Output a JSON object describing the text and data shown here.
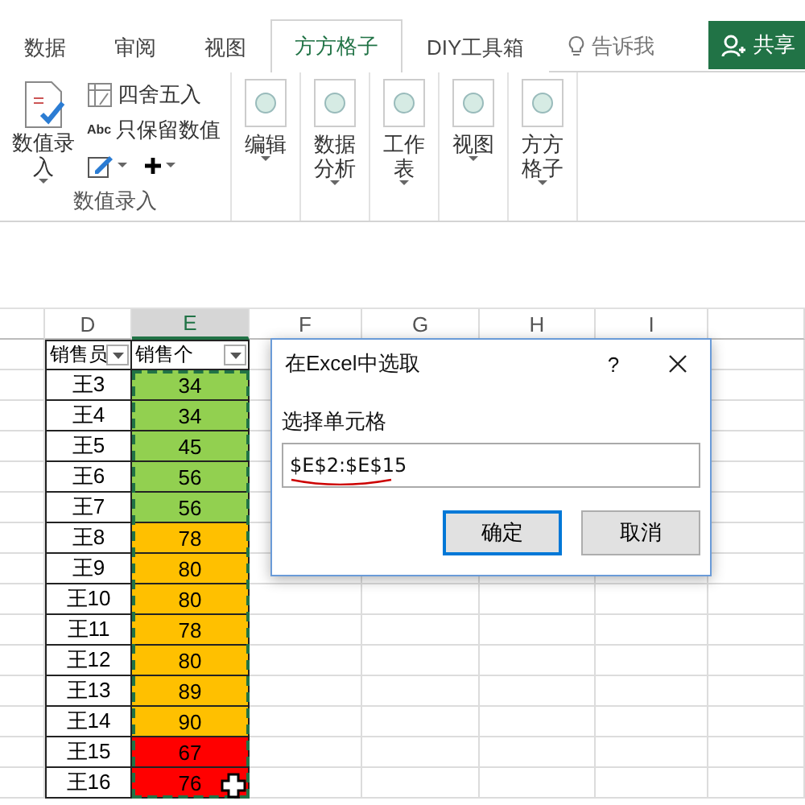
{
  "tabs": [
    {
      "label": "数据",
      "selected": false
    },
    {
      "label": "审阅",
      "selected": false
    },
    {
      "label": "视图",
      "selected": false
    },
    {
      "label": "方方格子",
      "selected": true
    },
    {
      "label": "DIY工具箱",
      "selected": false
    }
  ],
  "tell_me": {
    "label": "告诉我"
  },
  "share_button": {
    "label": "共享"
  },
  "ribbon": {
    "group": {
      "label": "数值录入",
      "big_button": {
        "label": "数值录入"
      },
      "small_buttons": [
        {
          "kind": "table",
          "label": "四舍五入"
        },
        {
          "kind": "abc",
          "icon_text": "Abc",
          "label": "只保留数值"
        }
      ]
    },
    "tool_buttons": [
      {
        "label": "编辑"
      },
      {
        "label": "数据分析"
      },
      {
        "label": "工作表"
      },
      {
        "label": "视图"
      },
      {
        "label": "方方格子"
      }
    ]
  },
  "sheet": {
    "columns": [
      {
        "label": "D",
        "selected": false
      },
      {
        "label": "E",
        "selected": true
      },
      {
        "label": "F",
        "selected": false
      },
      {
        "label": "G",
        "selected": false
      },
      {
        "label": "H",
        "selected": false
      },
      {
        "label": "I",
        "selected": false
      }
    ],
    "header_row": [
      "销售员",
      "销售个"
    ],
    "rows": [
      {
        "name": "王3",
        "value": "34",
        "color": "#92d050"
      },
      {
        "name": "王4",
        "value": "34",
        "color": "#92d050"
      },
      {
        "name": "王5",
        "value": "45",
        "color": "#92d050"
      },
      {
        "name": "王6",
        "value": "56",
        "color": "#92d050"
      },
      {
        "name": "王7",
        "value": "56",
        "color": "#92d050"
      },
      {
        "name": "王8",
        "value": "78",
        "color": "#ffc000"
      },
      {
        "name": "王9",
        "value": "80",
        "color": "#ffc000"
      },
      {
        "name": "王10",
        "value": "80",
        "color": "#ffc000"
      },
      {
        "name": "王11",
        "value": "78",
        "color": "#ffc000"
      },
      {
        "name": "王12",
        "value": "80",
        "color": "#ffc000"
      },
      {
        "name": "王13",
        "value": "89",
        "color": "#ffc000"
      },
      {
        "name": "王14",
        "value": "90",
        "color": "#ffc000"
      },
      {
        "name": "王15",
        "value": "67",
        "color": "#ff0000"
      },
      {
        "name": "王16",
        "value": "76",
        "color": "#ff0000"
      }
    ]
  },
  "dialog": {
    "title": "在Excel中选取",
    "help": "?",
    "label": "选择单元格",
    "value": "$E$2:$E$15",
    "buttons": [
      {
        "label": "确定",
        "focused": true
      },
      {
        "label": "取消",
        "focused": false
      }
    ]
  }
}
